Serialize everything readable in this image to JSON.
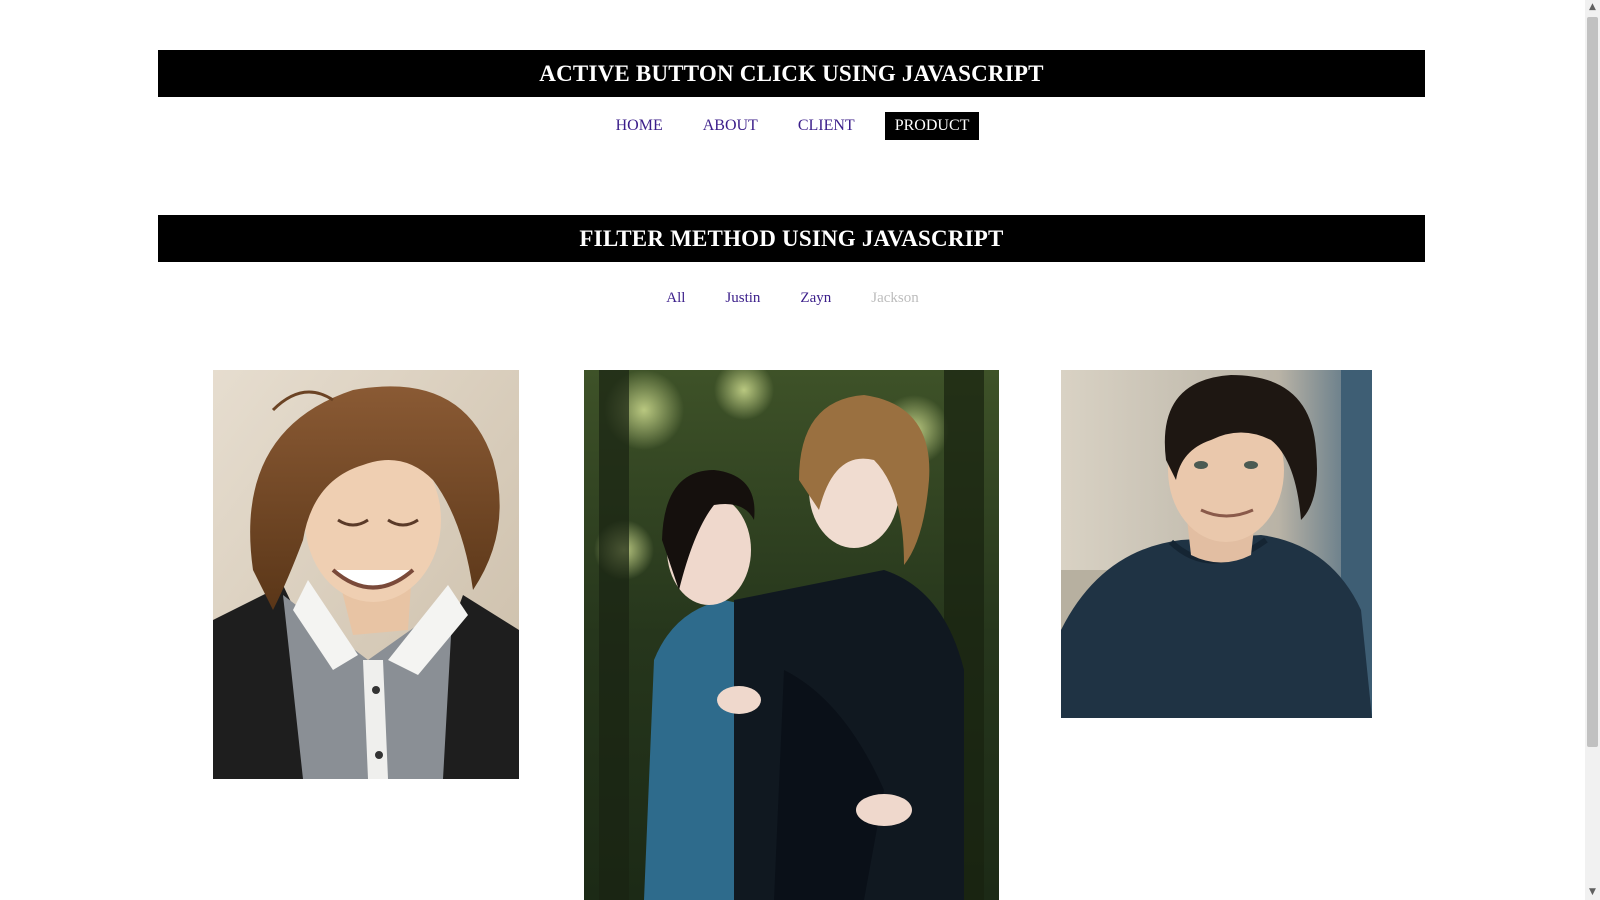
{
  "header": {
    "title": "ACTIVE BUTTON CLICK USING JAVASCRIPT"
  },
  "nav": {
    "items": [
      {
        "label": "HOME",
        "active": false
      },
      {
        "label": "ABOUT",
        "active": false
      },
      {
        "label": "CLIENT",
        "active": false
      },
      {
        "label": "PRODUCT",
        "active": true
      }
    ]
  },
  "filter_section": {
    "title": "FILTER METHOD USING JAVASCRIPT",
    "filters": [
      {
        "label": "All",
        "current": false
      },
      {
        "label": "Justin",
        "current": false
      },
      {
        "label": "Zayn",
        "current": false
      },
      {
        "label": "Jackson",
        "current": true
      }
    ]
  },
  "colors": {
    "bar_background": "#000000",
    "bar_text": "#ffffff",
    "link": "#3b1e8a",
    "active_bg": "#000000",
    "inactive_filter": "#bdbdbd"
  },
  "scrollbar": {
    "up_icon": "chevron-up-icon",
    "down_icon": "chevron-down-icon"
  }
}
